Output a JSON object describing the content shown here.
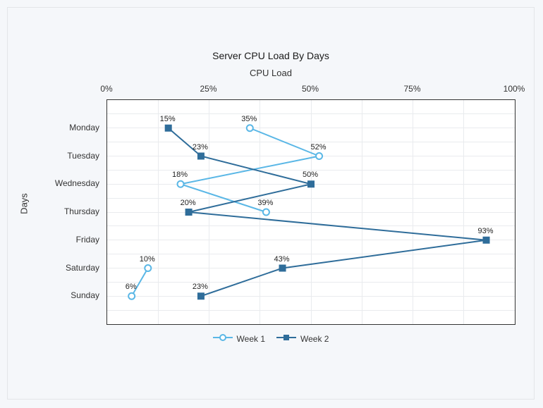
{
  "chart_data": {
    "type": "line",
    "title": "Server CPU Load By Days",
    "xlabel": "CPU Load",
    "ylabel": "Days",
    "x_ticks": [
      "0%",
      "25%",
      "50%",
      "75%",
      "100%"
    ],
    "x_tick_values": [
      0,
      25,
      50,
      75,
      100
    ],
    "categories": [
      "Monday",
      "Tuesday",
      "Wednesday",
      "Thursday",
      "Friday",
      "Saturday",
      "Sunday"
    ],
    "series": [
      {
        "name": "Week 1",
        "color": "#5ab7e6",
        "marker": "circle-open",
        "values": [
          35,
          52,
          18,
          39,
          null,
          10,
          6
        ]
      },
      {
        "name": "Week 2",
        "color": "#2f6d9a",
        "marker": "square",
        "values": [
          15,
          23,
          50,
          20,
          93,
          43,
          23
        ]
      }
    ],
    "xlim": [
      0,
      100
    ],
    "value_suffix": "%",
    "legend_position": "bottom",
    "grid": true
  }
}
